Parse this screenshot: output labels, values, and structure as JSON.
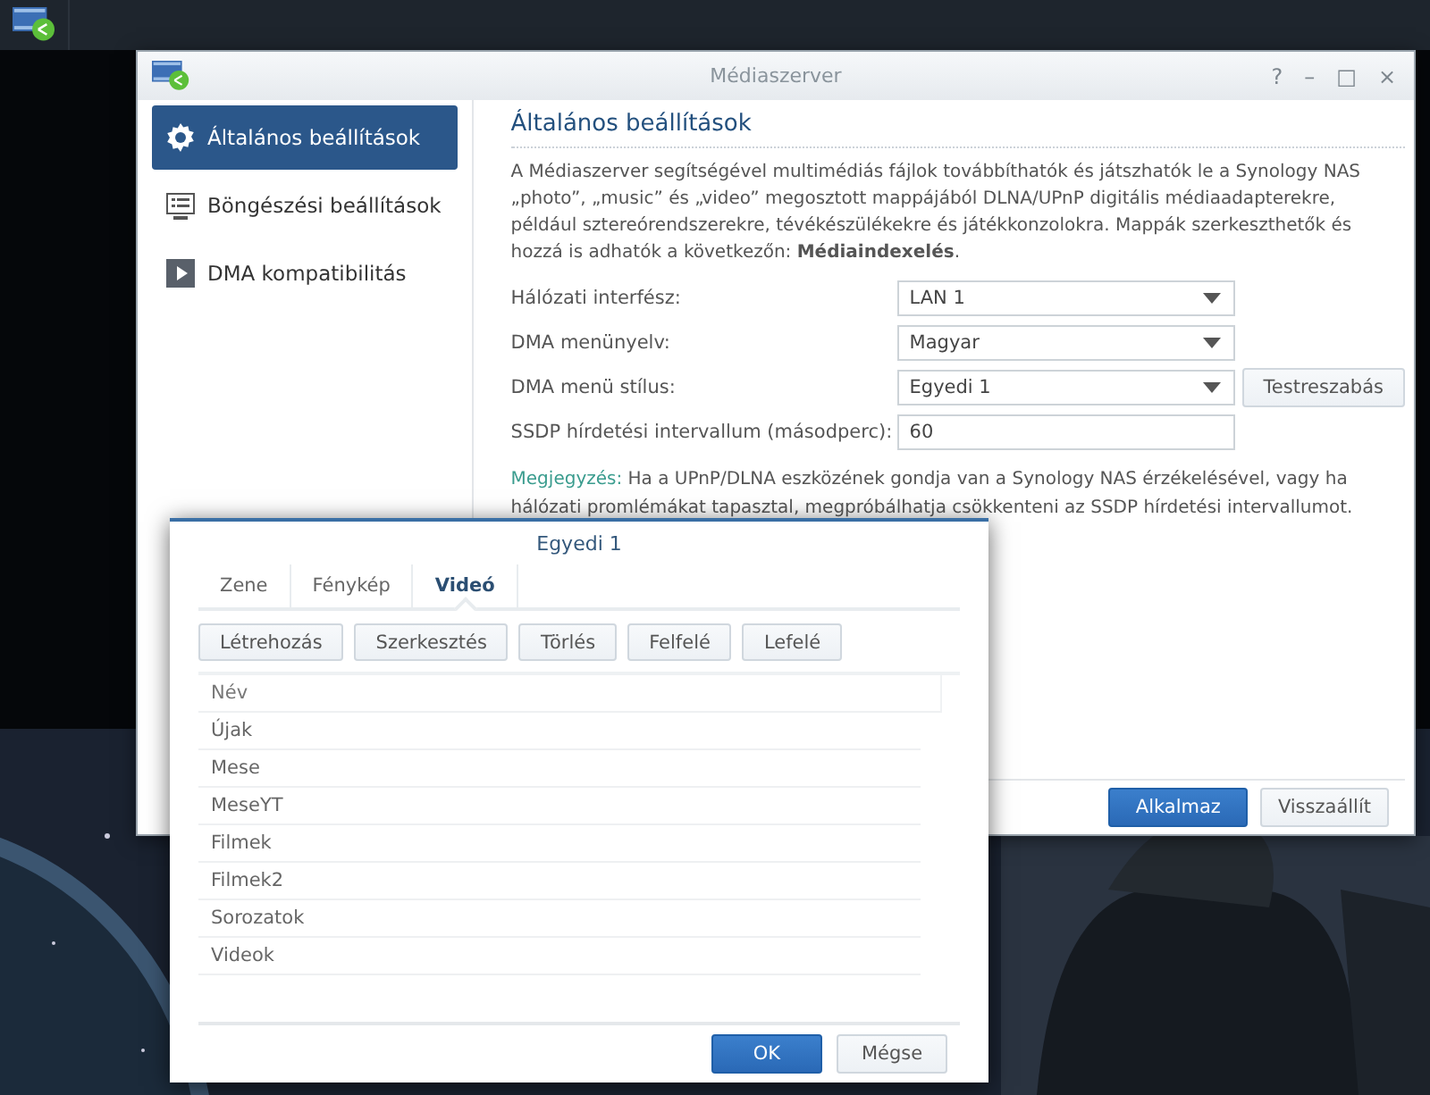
{
  "main_window": {
    "title": "Médiaszerver",
    "controls": [
      "?",
      "–",
      "□",
      "×"
    ],
    "sidebar": {
      "items": [
        {
          "label": "Általános beállítások",
          "selected": true
        },
        {
          "label": "Böngészési beállítások",
          "selected": false
        },
        {
          "label": "DMA kompatibilitás",
          "selected": false
        }
      ]
    },
    "content": {
      "heading": "Általános beállítások",
      "description": "A Médiaszerver segítségével multimédiás fájlok továbbíthatók és játszhatók le a Synology NAS „photo”, „music” és „video” megosztott mappájából DLNA/UPnP digitális médiaadapterekre, például sztereórendszerekre, tévékészülékekre és játékkonzolokra. Mappák szerkeszthetők és hozzá is adhatók a következőn: **Médiaindexelés**.",
      "fields": [
        {
          "kind": "select",
          "label": "Hálózati interfész:",
          "value": "LAN 1"
        },
        {
          "kind": "select",
          "label": "DMA menünyelv:",
          "value": "Magyar"
        },
        {
          "kind": "select",
          "label": "DMA menü stílus:",
          "value": "Egyedi 1",
          "button": "Testreszabás"
        },
        {
          "kind": "input",
          "label": "SSDP hírdetési intervallum (másodperc):",
          "value": "60"
        }
      ],
      "note": {
        "label": "Megjegyzés:",
        "text": "Ha a UPnP/DLNA eszközének gondja van a Synology NAS érzékelésével, vagy ha hálózati promlémákat tapasztal, megpróbálhatja csökkenteni az SSDP hírdetési intervallumot."
      }
    },
    "footer_buttons": [
      {
        "label": "Alkalmaz",
        "kind": "primary"
      },
      {
        "label": "Visszaállít",
        "kind": "default"
      }
    ]
  },
  "dialog": {
    "title": "Egyedi 1",
    "tabs": [
      {
        "label": "Zene",
        "selected": false
      },
      {
        "label": "Fénykép",
        "selected": false
      },
      {
        "label": "Videó",
        "selected": true
      }
    ],
    "toolbar": [
      "Létrehozás",
      "Szerkesztés",
      "Törlés",
      "Felfelé",
      "Lefelé"
    ],
    "table": {
      "columns": [
        "Név"
      ],
      "rows": [
        "Újak",
        "Mese",
        "MeseYT",
        "Filmek",
        "Filmek2",
        "Sorozatok",
        "Videok"
      ]
    },
    "footer_buttons": [
      {
        "label": "OK",
        "kind": "primary"
      },
      {
        "label": "Mégse",
        "kind": "default"
      }
    ]
  }
}
